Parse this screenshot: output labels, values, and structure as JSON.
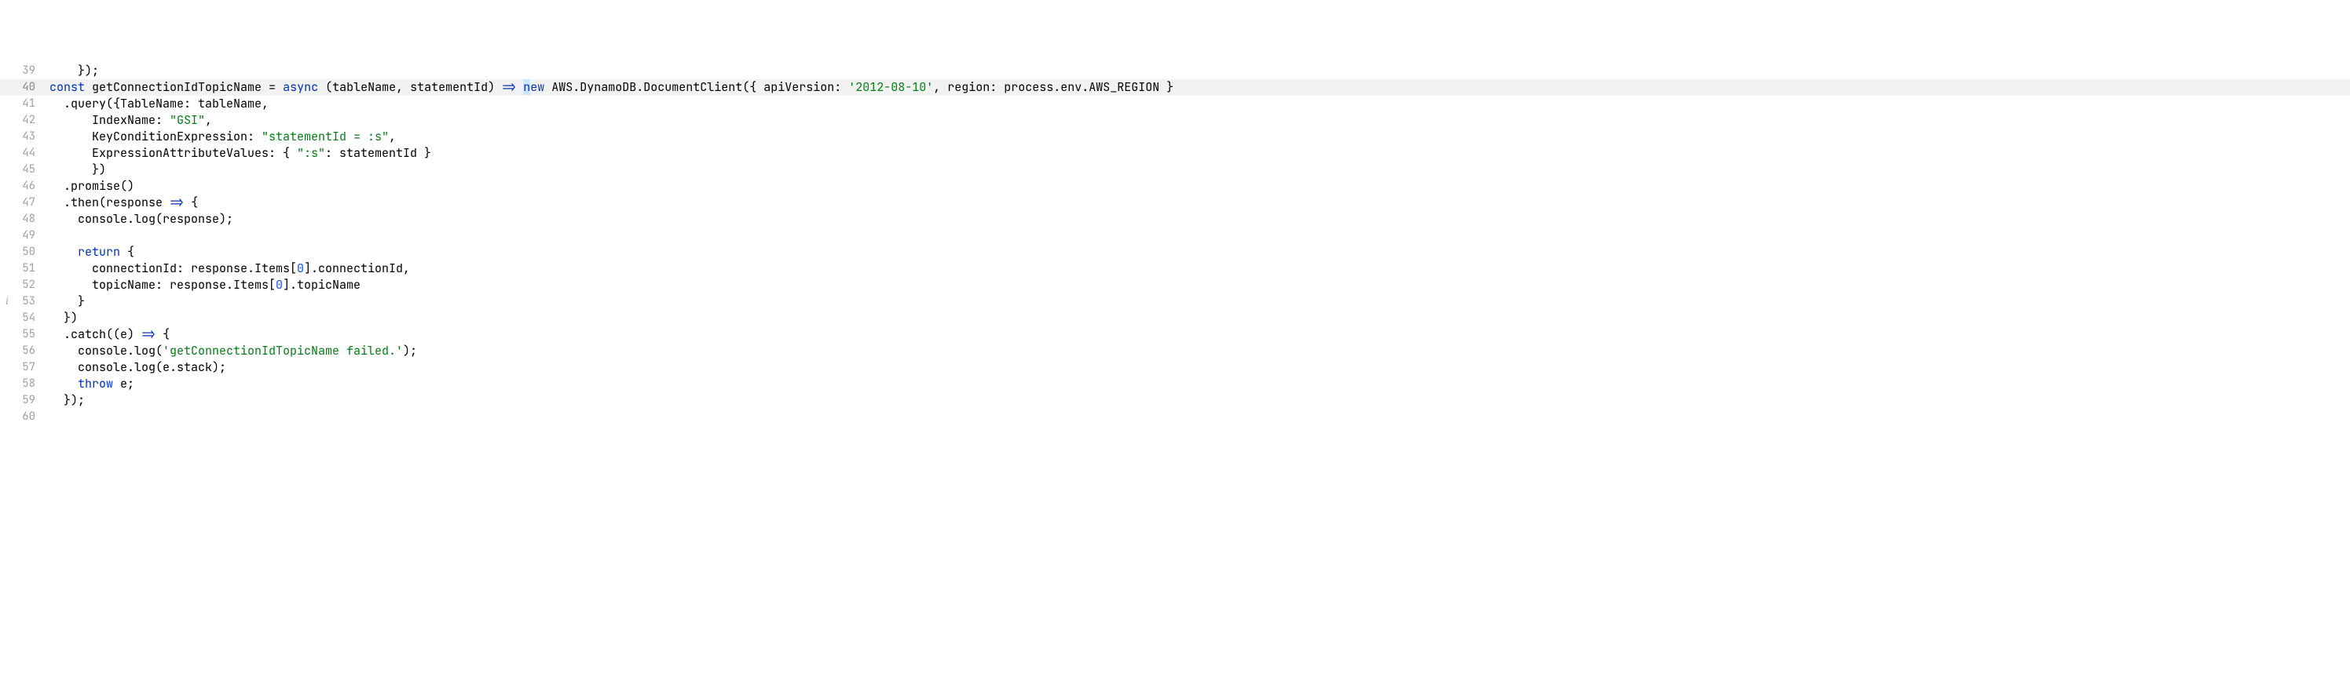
{
  "gutter": {
    "infoIcon": "i",
    "infoIconLine": 53
  },
  "highlightedLine": 40,
  "lines": [
    {
      "n": 39,
      "tokens": [
        {
          "cls": "",
          "t": "    });"
        }
      ]
    },
    {
      "n": 40,
      "tokens": [
        {
          "cls": "tok-kw",
          "t": "const"
        },
        {
          "cls": "",
          "t": " "
        },
        {
          "cls": "tok-def",
          "t": "getConnectionIdTopicName"
        },
        {
          "cls": "",
          "t": " = "
        },
        {
          "cls": "tok-kw",
          "t": "async"
        },
        {
          "cls": "",
          "t": " ("
        },
        {
          "cls": "tok-param",
          "t": "tableName"
        },
        {
          "cls": "",
          "t": ", "
        },
        {
          "cls": "tok-param",
          "t": "statementId"
        },
        {
          "cls": "",
          "t": ") "
        },
        {
          "cls": "tok-kw",
          "t": "=>"
        },
        {
          "cls": "",
          "t": " "
        },
        {
          "cls": "tok-sel tok-kw",
          "t": "n"
        },
        {
          "cls": "tok-kw",
          "t": "ew"
        },
        {
          "cls": "",
          "t": " AWS.DynamoDB.DocumentClient({ apiVersion: "
        },
        {
          "cls": "tok-str",
          "t": "'2012-08-10'"
        },
        {
          "cls": "",
          "t": ", region: process.env.AWS_REGION }"
        }
      ]
    },
    {
      "n": 41,
      "tokens": [
        {
          "cls": "",
          "t": "  .query({TableName: tableName,"
        }
      ]
    },
    {
      "n": 42,
      "tokens": [
        {
          "cls": "",
          "t": "      IndexName: "
        },
        {
          "cls": "tok-str",
          "t": "\"GSI\""
        },
        {
          "cls": "",
          "t": ","
        }
      ]
    },
    {
      "n": 43,
      "tokens": [
        {
          "cls": "",
          "t": "      KeyConditionExpression: "
        },
        {
          "cls": "tok-str",
          "t": "\"statementId = :s\""
        },
        {
          "cls": "",
          "t": ","
        }
      ]
    },
    {
      "n": 44,
      "tokens": [
        {
          "cls": "",
          "t": "      ExpressionAttributeValues: { "
        },
        {
          "cls": "tok-str",
          "t": "\":s\""
        },
        {
          "cls": "",
          "t": ": statementId }"
        }
      ]
    },
    {
      "n": 45,
      "tokens": [
        {
          "cls": "",
          "t": "      })"
        }
      ]
    },
    {
      "n": 46,
      "tokens": [
        {
          "cls": "",
          "t": "  .promise()"
        }
      ]
    },
    {
      "n": 47,
      "tokens": [
        {
          "cls": "",
          "t": "  .then("
        },
        {
          "cls": "tok-param",
          "t": "response"
        },
        {
          "cls": "",
          "t": " "
        },
        {
          "cls": "tok-kw",
          "t": "=>"
        },
        {
          "cls": "",
          "t": " {"
        }
      ]
    },
    {
      "n": 48,
      "tokens": [
        {
          "cls": "",
          "t": "    console.log(response);"
        }
      ]
    },
    {
      "n": 49,
      "tokens": [
        {
          "cls": "",
          "t": ""
        }
      ]
    },
    {
      "n": 50,
      "tokens": [
        {
          "cls": "",
          "t": "    "
        },
        {
          "cls": "tok-kw",
          "t": "return"
        },
        {
          "cls": "",
          "t": " {"
        }
      ]
    },
    {
      "n": 51,
      "tokens": [
        {
          "cls": "",
          "t": "      connectionId: response.Items["
        },
        {
          "cls": "tok-num",
          "t": "0"
        },
        {
          "cls": "",
          "t": "].connectionId,"
        }
      ]
    },
    {
      "n": 52,
      "tokens": [
        {
          "cls": "",
          "t": "      topicName: response.Items["
        },
        {
          "cls": "tok-num",
          "t": "0"
        },
        {
          "cls": "",
          "t": "].topicName"
        }
      ]
    },
    {
      "n": 53,
      "tokens": [
        {
          "cls": "",
          "t": "    }"
        }
      ]
    },
    {
      "n": 54,
      "tokens": [
        {
          "cls": "",
          "t": "  })"
        }
      ]
    },
    {
      "n": 55,
      "tokens": [
        {
          "cls": "",
          "t": "  .catch(("
        },
        {
          "cls": "tok-param",
          "t": "e"
        },
        {
          "cls": "",
          "t": ") "
        },
        {
          "cls": "tok-kw",
          "t": "=>"
        },
        {
          "cls": "",
          "t": " {"
        }
      ]
    },
    {
      "n": 56,
      "tokens": [
        {
          "cls": "",
          "t": "    console.log("
        },
        {
          "cls": "tok-str",
          "t": "'getConnectionIdTopicName failed.'"
        },
        {
          "cls": "",
          "t": ");"
        }
      ]
    },
    {
      "n": 57,
      "tokens": [
        {
          "cls": "",
          "t": "    console.log(e.stack);"
        }
      ]
    },
    {
      "n": 58,
      "tokens": [
        {
          "cls": "",
          "t": "    "
        },
        {
          "cls": "tok-kw",
          "t": "throw"
        },
        {
          "cls": "",
          "t": " e;"
        }
      ]
    },
    {
      "n": 59,
      "tokens": [
        {
          "cls": "",
          "t": "  });"
        }
      ]
    },
    {
      "n": 60,
      "tokens": [
        {
          "cls": "",
          "t": ""
        }
      ]
    }
  ]
}
